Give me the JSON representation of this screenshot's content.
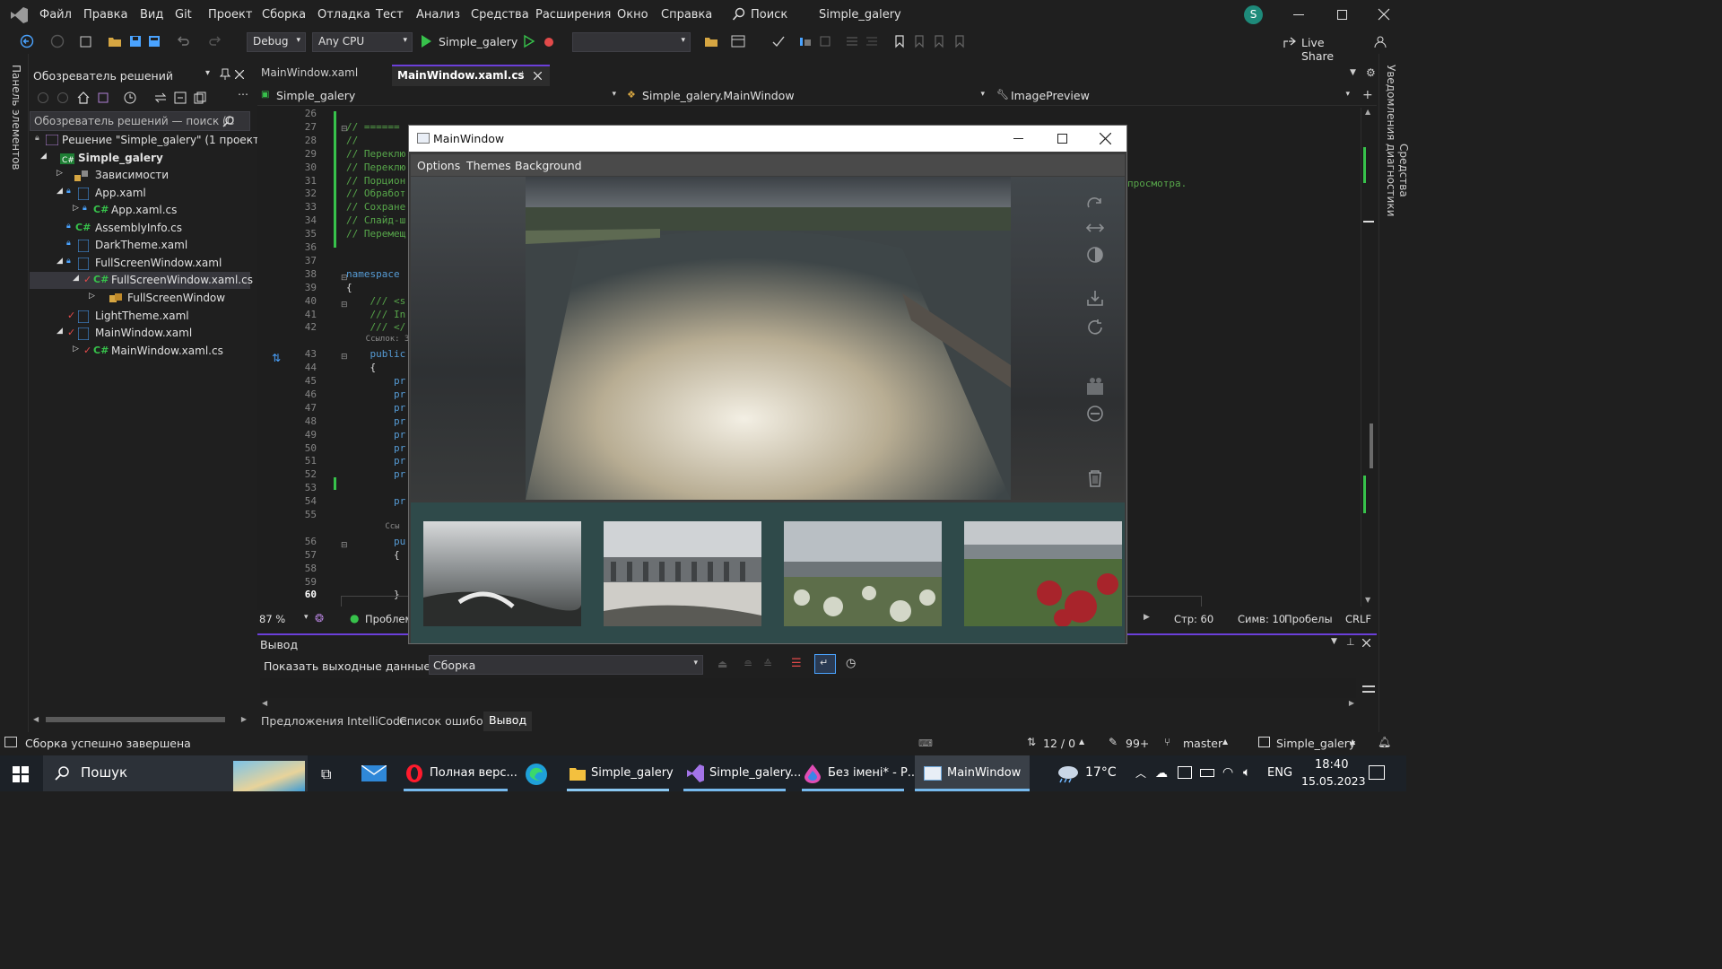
{
  "menubar": {
    "items": [
      "Файл",
      "Правка",
      "Вид",
      "Git",
      "Проект",
      "Сборка",
      "Отладка",
      "Тест",
      "Анализ",
      "Средства",
      "Расширения",
      "Окно",
      "Справка"
    ],
    "search_label": "Поиск",
    "solution_title": "Simple_galery",
    "avatar_letter": "S"
  },
  "toolbar": {
    "config": "Debug",
    "platform": "Any CPU",
    "run_target": "Simple_galery",
    "live_share": "Live Share"
  },
  "leftrail": {
    "label": "Панель элементов"
  },
  "rightrail": {
    "labels": [
      "Уведомления",
      "Средства диагностики"
    ]
  },
  "solution_explorer": {
    "title": "Обозреватель решений",
    "search_placeholder": "Обозреватель решений — поиск (C",
    "items": [
      {
        "label": "Решение \"Simple_galery\" (1 проекта"
      },
      {
        "label": "Simple_galery"
      },
      {
        "label": "Зависимости"
      },
      {
        "label": "App.xaml"
      },
      {
        "label": "App.xaml.cs"
      },
      {
        "label": "AssemblyInfo.cs"
      },
      {
        "label": "DarkTheme.xaml"
      },
      {
        "label": "FullScreenWindow.xaml"
      },
      {
        "label": "FullScreenWindow.xaml.cs"
      },
      {
        "label": "FullScreenWindow"
      },
      {
        "label": "LightTheme.xaml"
      },
      {
        "label": "MainWindow.xaml"
      },
      {
        "label": "MainWindow.xaml.cs"
      }
    ]
  },
  "editor": {
    "tabs": [
      {
        "label": "MainWindow.xaml"
      },
      {
        "label": "MainWindow.xaml.cs"
      }
    ],
    "nav_project": "Simple_galery",
    "nav_class": "Simple_galery.MainWindow",
    "nav_member": "ImagePreview",
    "code_lines": [
      {
        "n": "26",
        "t": ""
      },
      {
        "n": "27",
        "t": "// ======"
      },
      {
        "n": "28",
        "t": "//"
      },
      {
        "n": "29",
        "t": "// Переклю"
      },
      {
        "n": "30",
        "t": "// Переклю"
      },
      {
        "n": "31",
        "t": "// Порцион"
      },
      {
        "n": "32",
        "t": "// Обработ"
      },
      {
        "n": "33",
        "t": "// Сохране"
      },
      {
        "n": "34",
        "t": "// Слайд-ш"
      },
      {
        "n": "35",
        "t": "// Перемещ"
      },
      {
        "n": "36",
        "t": ""
      },
      {
        "n": "37",
        "t": ""
      },
      {
        "n": "38",
        "t": "namespace"
      },
      {
        "n": "39",
        "t": "{"
      },
      {
        "n": "40",
        "t": "    /// <s"
      },
      {
        "n": "41",
        "t": "    /// In"
      },
      {
        "n": "42",
        "t": "    /// </"
      },
      {
        "n": "",
        "t": "    Ссылок: 3"
      },
      {
        "n": "43",
        "t": "    public"
      },
      {
        "n": "44",
        "t": "    {"
      },
      {
        "n": "45",
        "t": "        pr"
      },
      {
        "n": "46",
        "t": "        pr"
      },
      {
        "n": "47",
        "t": "        pr"
      },
      {
        "n": "48",
        "t": "        pr"
      },
      {
        "n": "49",
        "t": "        pr"
      },
      {
        "n": "50",
        "t": "        pr"
      },
      {
        "n": "51",
        "t": "        pr"
      },
      {
        "n": "52",
        "t": "        pr"
      },
      {
        "n": "53",
        "t": ""
      },
      {
        "n": "54",
        "t": "        pr"
      },
      {
        "n": "55",
        "t": ""
      },
      {
        "n": "",
        "t": "        Ссы"
      },
      {
        "n": "56",
        "t": "        pu"
      },
      {
        "n": "57",
        "t": "        {"
      },
      {
        "n": "58",
        "t": ""
      },
      {
        "n": "59",
        "t": ""
      },
      {
        "n": "60",
        "t": "        }"
      }
    ],
    "code_right_fragment": "просмотра.",
    "zoom": "87 %",
    "issues": "Проблем",
    "row": "Стр: 60",
    "col": "Симв: 10",
    "spaces": "Пробелы",
    "eol": "CRLF"
  },
  "main_window": {
    "title": "MainWindow",
    "menu": [
      "Options",
      "Themes",
      "Background"
    ],
    "tools": [
      "rotate-icon",
      "flip-horizontal-icon",
      "contrast-icon",
      "save-icon",
      "refresh-icon",
      "slideshow-icon",
      "remove-icon",
      "trash-icon"
    ]
  },
  "output": {
    "title": "Вывод",
    "source_label": "Показать выходные данные из:",
    "source_value": "Сборка",
    "tabs": [
      "Предложения IntelliCode",
      "Список ошибок",
      "Вывод"
    ]
  },
  "statusbar": {
    "message": "Сборка успешно завершена",
    "lines": "12 / 0",
    "edits": "99+",
    "branch": "master",
    "repo": "Simple_galery"
  },
  "taskbar": {
    "search": "Пошук",
    "apps": [
      "Полная верс...",
      "Simple_galery",
      "Simple_galery...",
      "Без імені* - Р...",
      "MainWindow"
    ],
    "temperature": "17°C",
    "lang": "ENG",
    "time": "18:40",
    "date": "15.05.2023"
  },
  "colors": {
    "accent": "#6b3fd9",
    "comment": "#57a64a",
    "keyword": "#569cd6",
    "gallery_bg": "#2f4a4a"
  }
}
